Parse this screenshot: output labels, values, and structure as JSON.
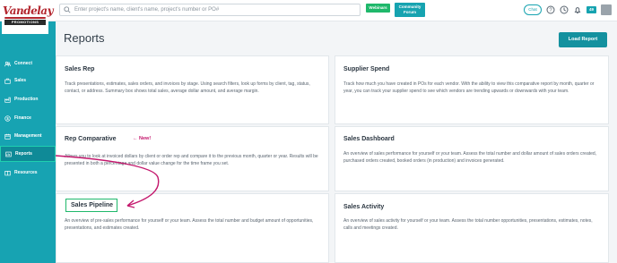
{
  "header": {
    "logo_text": "Vandelay",
    "logo_sub": "PROMOTIONS",
    "search_placeholder": "Enter project's name, client's name, project's number or PO#",
    "webinars_label": "Webinars",
    "forum_label": "Community Forum",
    "chat_label": "Chat",
    "badge_count": "49"
  },
  "sidebar": {
    "items": [
      {
        "label": "Connect",
        "icon": "connect-icon"
      },
      {
        "label": "Sales",
        "icon": "sales-icon"
      },
      {
        "label": "Production",
        "icon": "production-icon"
      },
      {
        "label": "Finance",
        "icon": "finance-icon"
      },
      {
        "label": "Management",
        "icon": "management-icon"
      },
      {
        "label": "Reports",
        "icon": "reports-icon"
      },
      {
        "label": "Resources",
        "icon": "resources-icon"
      }
    ]
  },
  "main": {
    "title": "Reports",
    "load_report_label": "Load Report",
    "cards": [
      {
        "title": "Sales Rep",
        "desc": "Track presentations, estimates, sales orders, and invoices by stage. Using search filters, look up forms by client, tag, status, contact, or address. Summary box shows total sales, average dollar amount, and average margin."
      },
      {
        "title": "Supplier Spend",
        "desc": "Track how much you have created in POs for each vendor. With the ability to view this comparative report by month, quarter or year, you can track your supplier spend to see which vendors are trending upwards or downwards with your team."
      },
      {
        "title": "Rep Comparative",
        "badge": "New!",
        "desc": "Allows you to look at invoiced dollars by client or order rep and compare it to the previous month, quarter or year. Results will be presented in both a percentage and dollar value change for the time frame you set."
      },
      {
        "title": "Sales Dashboard",
        "desc": "An overview of sales performance for yourself or your team. Assess the total number and dollar amount of sales orders created, purchased orders created, booked orders (in production) and invoices generated."
      },
      {
        "title": "Sales Pipeline",
        "desc": "An overview of pre-sales performance for yourself or your team. Assess the total number and budget amount of opportunities, presentations, and estimates created."
      },
      {
        "title": "Sales Activity",
        "desc": "An overview of sales activity for yourself or your team. Assess the total number opportunities, presentations, estimates, notes, calls and meetings created."
      }
    ]
  },
  "colors": {
    "sidebar": "#17a3b2",
    "accent": "#14919f",
    "highlight": "#1fb86b",
    "annotation": "#c4186d"
  }
}
